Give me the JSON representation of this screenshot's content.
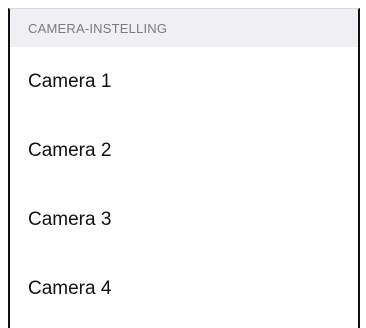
{
  "section": {
    "title": "CAMERA-INSTELLING"
  },
  "items": [
    {
      "label": "Camera 1"
    },
    {
      "label": "Camera 2"
    },
    {
      "label": "Camera 3"
    },
    {
      "label": "Camera 4"
    }
  ]
}
